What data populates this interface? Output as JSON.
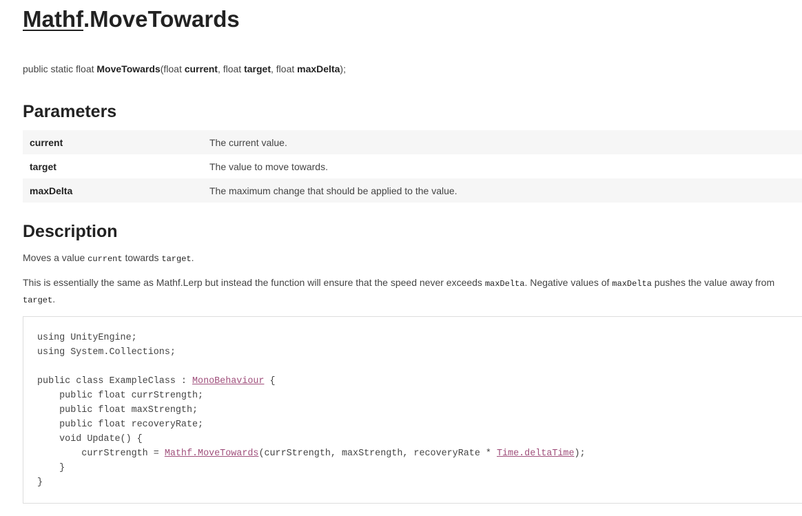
{
  "title": {
    "class_link": "Mathf",
    "separator": ".",
    "method": "MoveTowards"
  },
  "signature": {
    "prefix": "public static float ",
    "method": "MoveTowards",
    "open": "(float ",
    "param1": "current",
    "sep1": ", float ",
    "param2": "target",
    "sep2": ", float ",
    "param3": "maxDelta",
    "close": ");"
  },
  "parameters": {
    "heading": "Parameters",
    "rows": [
      {
        "name": "current",
        "description": "The current value."
      },
      {
        "name": "target",
        "description": "The value to move towards."
      },
      {
        "name": "maxDelta",
        "description": "The maximum change that should be applied to the value."
      }
    ]
  },
  "description": {
    "heading": "Description",
    "p1": {
      "t1": "Moves a value ",
      "c1": "current",
      "t2": " towards ",
      "c2": "target",
      "t3": "."
    },
    "p2": {
      "t1": "This is essentially the same as Mathf.Lerp but instead the function will ensure that the speed never exceeds ",
      "c1": "maxDelta",
      "t2": ". Negative values of ",
      "c2": "maxDelta",
      "t3": " pushes the value away from ",
      "c3": "target",
      "t4": "."
    }
  },
  "code": {
    "line1": "using UnityEngine;",
    "line2": "using System.Collections;",
    "line3": "",
    "line4_pre": "public class ExampleClass : ",
    "line4_link": "MonoBehaviour",
    "line4_post": " {",
    "line5": "    public float currStrength;",
    "line6": "    public float maxStrength;",
    "line7": "    public float recoveryRate;",
    "line8": "    void Update() {",
    "line9_pre": "        currStrength = ",
    "line9_link1": "Mathf.MoveTowards",
    "line9_mid": "(currStrength, maxStrength, recoveryRate * ",
    "line9_link2": "Time.deltaTime",
    "line9_post": ");",
    "line10": "    }",
    "line11": "}"
  }
}
